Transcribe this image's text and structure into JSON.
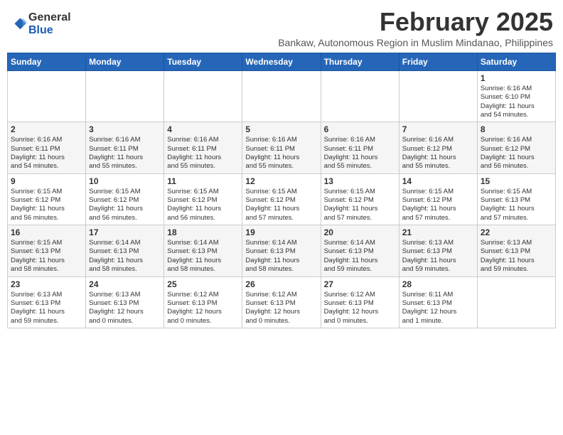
{
  "logo": {
    "general": "General",
    "blue": "Blue"
  },
  "title": "February 2025",
  "subtitle": "Bankaw, Autonomous Region in Muslim Mindanao, Philippines",
  "days_of_week": [
    "Sunday",
    "Monday",
    "Tuesday",
    "Wednesday",
    "Thursday",
    "Friday",
    "Saturday"
  ],
  "weeks": [
    {
      "days": [
        {
          "date": "",
          "info": ""
        },
        {
          "date": "",
          "info": ""
        },
        {
          "date": "",
          "info": ""
        },
        {
          "date": "",
          "info": ""
        },
        {
          "date": "",
          "info": ""
        },
        {
          "date": "",
          "info": ""
        },
        {
          "date": "1",
          "info": "Sunrise: 6:16 AM\nSunset: 6:10 PM\nDaylight: 11 hours\nand 54 minutes."
        }
      ]
    },
    {
      "days": [
        {
          "date": "2",
          "info": "Sunrise: 6:16 AM\nSunset: 6:11 PM\nDaylight: 11 hours\nand 54 minutes."
        },
        {
          "date": "3",
          "info": "Sunrise: 6:16 AM\nSunset: 6:11 PM\nDaylight: 11 hours\nand 55 minutes."
        },
        {
          "date": "4",
          "info": "Sunrise: 6:16 AM\nSunset: 6:11 PM\nDaylight: 11 hours\nand 55 minutes."
        },
        {
          "date": "5",
          "info": "Sunrise: 6:16 AM\nSunset: 6:11 PM\nDaylight: 11 hours\nand 55 minutes."
        },
        {
          "date": "6",
          "info": "Sunrise: 6:16 AM\nSunset: 6:11 PM\nDaylight: 11 hours\nand 55 minutes."
        },
        {
          "date": "7",
          "info": "Sunrise: 6:16 AM\nSunset: 6:12 PM\nDaylight: 11 hours\nand 55 minutes."
        },
        {
          "date": "8",
          "info": "Sunrise: 6:16 AM\nSunset: 6:12 PM\nDaylight: 11 hours\nand 56 minutes."
        }
      ]
    },
    {
      "days": [
        {
          "date": "9",
          "info": "Sunrise: 6:15 AM\nSunset: 6:12 PM\nDaylight: 11 hours\nand 56 minutes."
        },
        {
          "date": "10",
          "info": "Sunrise: 6:15 AM\nSunset: 6:12 PM\nDaylight: 11 hours\nand 56 minutes."
        },
        {
          "date": "11",
          "info": "Sunrise: 6:15 AM\nSunset: 6:12 PM\nDaylight: 11 hours\nand 56 minutes."
        },
        {
          "date": "12",
          "info": "Sunrise: 6:15 AM\nSunset: 6:12 PM\nDaylight: 11 hours\nand 57 minutes."
        },
        {
          "date": "13",
          "info": "Sunrise: 6:15 AM\nSunset: 6:12 PM\nDaylight: 11 hours\nand 57 minutes."
        },
        {
          "date": "14",
          "info": "Sunrise: 6:15 AM\nSunset: 6:12 PM\nDaylight: 11 hours\nand 57 minutes."
        },
        {
          "date": "15",
          "info": "Sunrise: 6:15 AM\nSunset: 6:13 PM\nDaylight: 11 hours\nand 57 minutes."
        }
      ]
    },
    {
      "days": [
        {
          "date": "16",
          "info": "Sunrise: 6:15 AM\nSunset: 6:13 PM\nDaylight: 11 hours\nand 58 minutes."
        },
        {
          "date": "17",
          "info": "Sunrise: 6:14 AM\nSunset: 6:13 PM\nDaylight: 11 hours\nand 58 minutes."
        },
        {
          "date": "18",
          "info": "Sunrise: 6:14 AM\nSunset: 6:13 PM\nDaylight: 11 hours\nand 58 minutes."
        },
        {
          "date": "19",
          "info": "Sunrise: 6:14 AM\nSunset: 6:13 PM\nDaylight: 11 hours\nand 58 minutes."
        },
        {
          "date": "20",
          "info": "Sunrise: 6:14 AM\nSunset: 6:13 PM\nDaylight: 11 hours\nand 59 minutes."
        },
        {
          "date": "21",
          "info": "Sunrise: 6:13 AM\nSunset: 6:13 PM\nDaylight: 11 hours\nand 59 minutes."
        },
        {
          "date": "22",
          "info": "Sunrise: 6:13 AM\nSunset: 6:13 PM\nDaylight: 11 hours\nand 59 minutes."
        }
      ]
    },
    {
      "days": [
        {
          "date": "23",
          "info": "Sunrise: 6:13 AM\nSunset: 6:13 PM\nDaylight: 11 hours\nand 59 minutes."
        },
        {
          "date": "24",
          "info": "Sunrise: 6:13 AM\nSunset: 6:13 PM\nDaylight: 12 hours\nand 0 minutes."
        },
        {
          "date": "25",
          "info": "Sunrise: 6:12 AM\nSunset: 6:13 PM\nDaylight: 12 hours\nand 0 minutes."
        },
        {
          "date": "26",
          "info": "Sunrise: 6:12 AM\nSunset: 6:13 PM\nDaylight: 12 hours\nand 0 minutes."
        },
        {
          "date": "27",
          "info": "Sunrise: 6:12 AM\nSunset: 6:13 PM\nDaylight: 12 hours\nand 0 minutes."
        },
        {
          "date": "28",
          "info": "Sunrise: 6:11 AM\nSunset: 6:13 PM\nDaylight: 12 hours\nand 1 minute."
        },
        {
          "date": "",
          "info": ""
        }
      ]
    }
  ]
}
